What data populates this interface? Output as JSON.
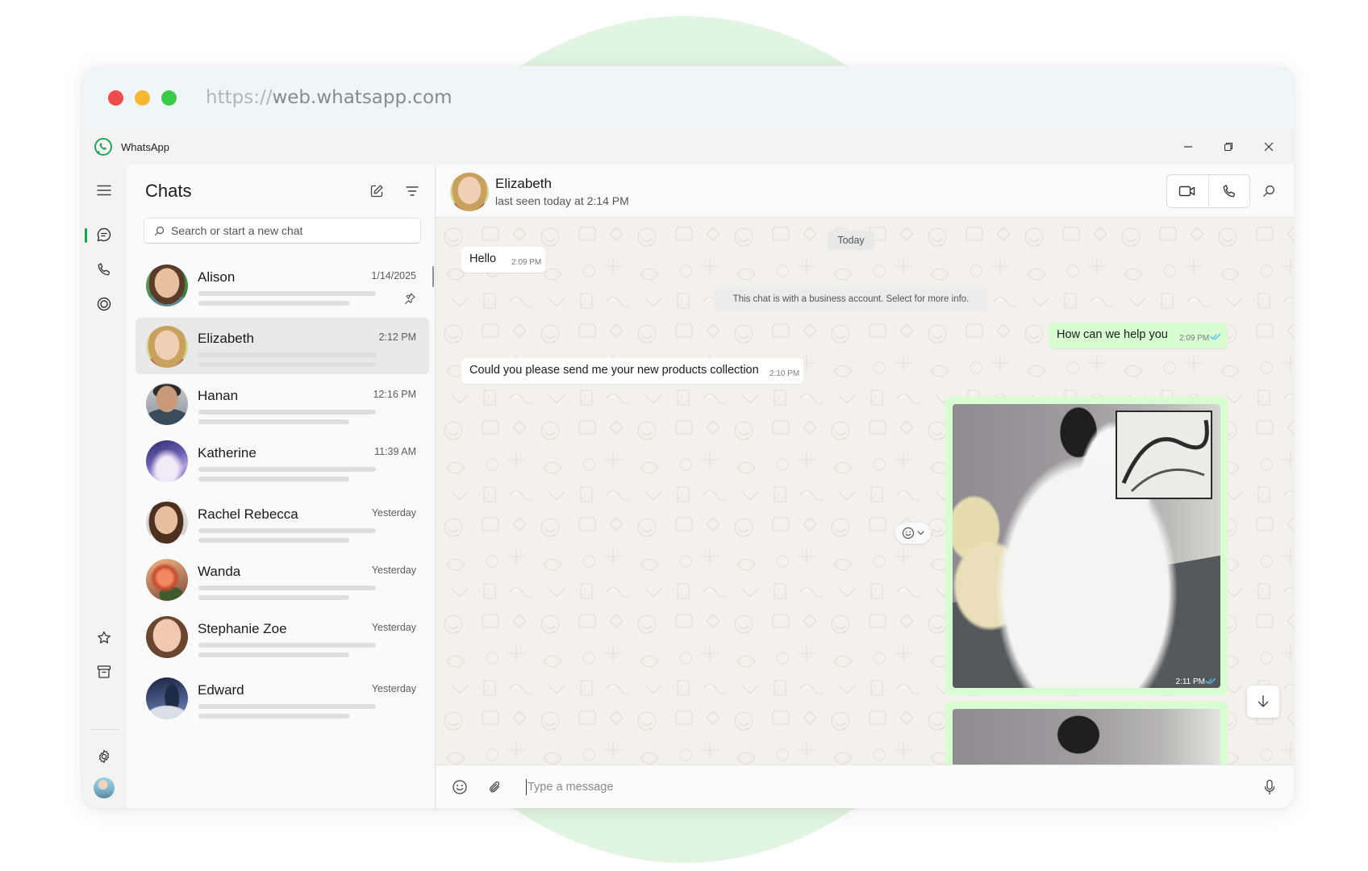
{
  "browser": {
    "url_scheme": "https://",
    "url_host": "web.whatsapp.com"
  },
  "titlebar": {
    "app_name": "WhatsApp"
  },
  "sidebar": {
    "title": "Chats",
    "search_placeholder": "Search or start a new chat",
    "chats": [
      {
        "name": "Alison",
        "time": "1/14/2025",
        "pinned": true
      },
      {
        "name": "Elizabeth",
        "time": "2:12 PM",
        "selected": true
      },
      {
        "name": "Hanan",
        "time": "12:16 PM"
      },
      {
        "name": "Katherine",
        "time": "11:39 AM"
      },
      {
        "name": "Rachel Rebecca",
        "time": "Yesterday"
      },
      {
        "name": "Wanda",
        "time": "Yesterday"
      },
      {
        "name": "Stephanie Zoe",
        "time": "Yesterday"
      },
      {
        "name": "Edward",
        "time": "Yesterday"
      }
    ]
  },
  "conversation": {
    "contact_name": "Elizabeth",
    "status": "last seen today at 2:14 PM",
    "date_divider": "Today",
    "messages": [
      {
        "direction": "in",
        "text": "Hello",
        "time": "2:09 PM"
      },
      {
        "direction": "system",
        "text": "This chat is with a business account. Select for more info."
      },
      {
        "direction": "out",
        "text": "How can we help you",
        "time": "2:09 PM",
        "read": true
      },
      {
        "direction": "in",
        "text": "Could you please send me your new products collection",
        "time": "2:10 PM"
      },
      {
        "direction": "out",
        "type": "image",
        "time": "2:11 PM"
      }
    ],
    "composer_placeholder": "Type a message"
  },
  "colors": {
    "accent_green": "#1d9e4d",
    "outgoing_bubble": "#d9fdd3",
    "read_ticks": "#53bdeb"
  }
}
